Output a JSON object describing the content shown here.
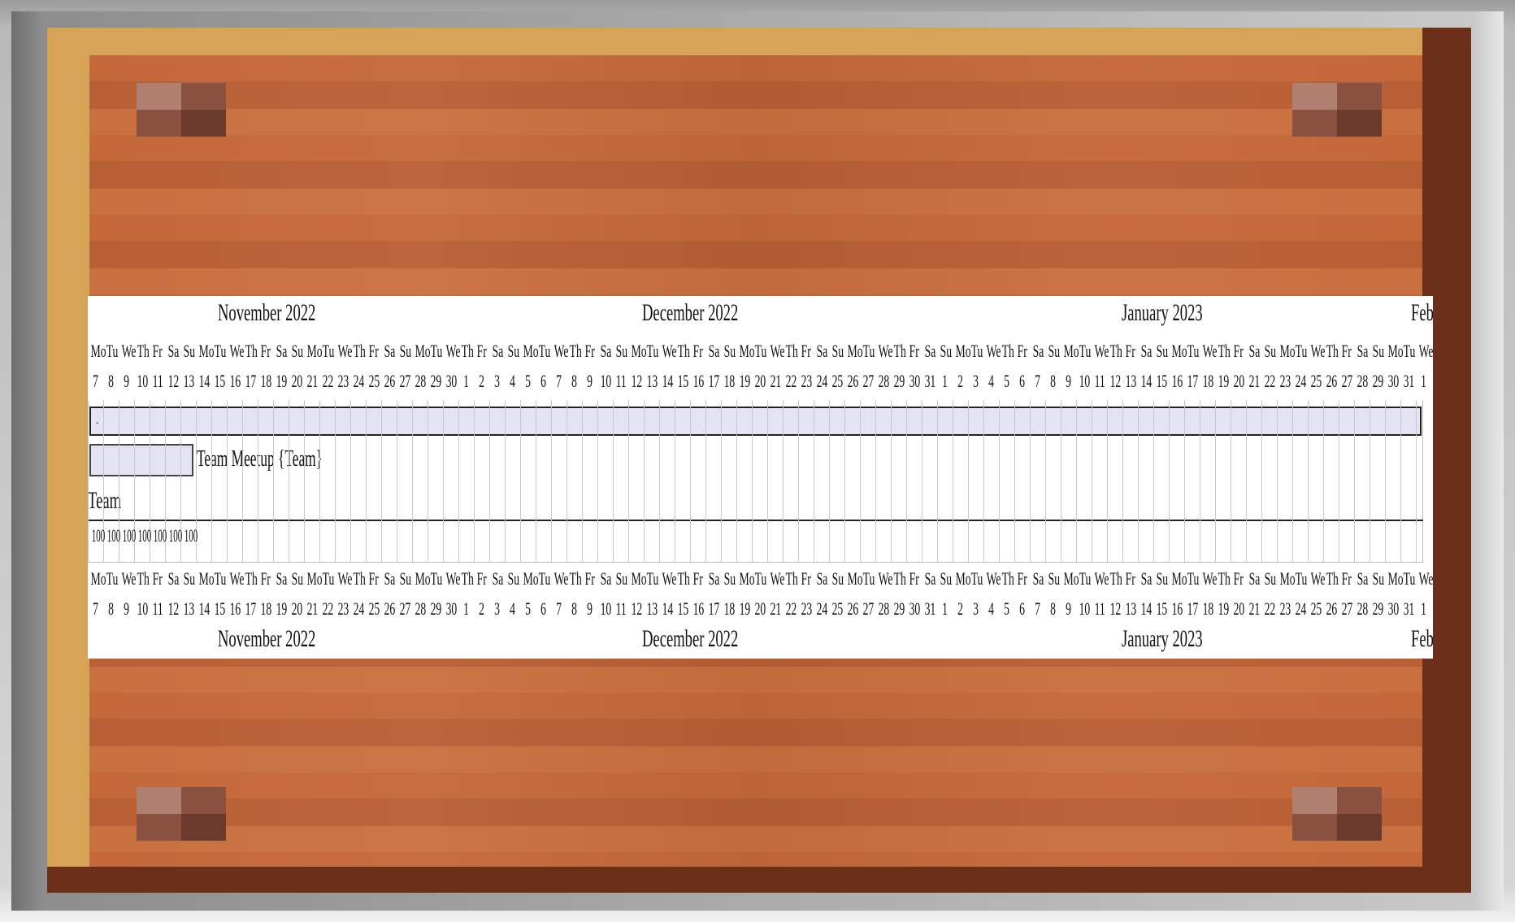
{
  "board": {
    "colors": {
      "wood": "#c4683a",
      "wood_dark": "#6b2f1a",
      "wood_highlight": "#d6a456",
      "frame": "#b9b9b9"
    },
    "stud_icons": [
      "stud-icon",
      "stud-icon",
      "stud-icon",
      "stud-icon"
    ]
  },
  "gantt": {
    "months": [
      {
        "label": "November 2022"
      },
      {
        "label": "December 2022"
      },
      {
        "label": "January 2023"
      },
      {
        "label": "Feb"
      }
    ],
    "day_names": [
      "Mo",
      "Tu",
      "We",
      "Th",
      "Fr",
      "Sa",
      "Su",
      "Mo",
      "Tu",
      "We",
      "Th",
      "Fr",
      "Sa",
      "Su",
      "Mo",
      "Tu",
      "We",
      "Th",
      "Fr",
      "Sa",
      "Su",
      "Mo",
      "Tu",
      "We",
      "Th",
      "Fr",
      "Sa",
      "Su",
      "Mo",
      "Tu",
      "We",
      "Th",
      "Fr",
      "Sa",
      "Su",
      "Mo",
      "Tu",
      "We",
      "Th",
      "Fr",
      "Sa",
      "Su",
      "Mo",
      "Tu",
      "We",
      "Th",
      "Fr",
      "Sa",
      "Su",
      "Mo",
      "Tu",
      "We",
      "Th",
      "Fr",
      "Sa",
      "Su",
      "Mo",
      "Tu",
      "We",
      "Th",
      "Fr",
      "Sa",
      "Su",
      "Mo",
      "Tu",
      "We",
      "Th",
      "Fr",
      "Sa",
      "Su",
      "Mo",
      "Tu",
      "We",
      "Th",
      "Fr",
      "Sa",
      "Su",
      "Mo",
      "Tu",
      "We",
      "Th",
      "Fr",
      "Sa",
      "Su",
      "Mo",
      "Tu",
      "We"
    ],
    "day_numbers": [
      "7",
      "8",
      "9",
      "10",
      "11",
      "12",
      "13",
      "14",
      "15",
      "16",
      "17",
      "18",
      "19",
      "20",
      "21",
      "22",
      "23",
      "24",
      "25",
      "26",
      "27",
      "28",
      "29",
      "30",
      "1",
      "2",
      "3",
      "4",
      "5",
      "6",
      "7",
      "8",
      "9",
      "10",
      "11",
      "12",
      "13",
      "14",
      "15",
      "16",
      "17",
      "18",
      "19",
      "20",
      "21",
      "22",
      "23",
      "24",
      "25",
      "26",
      "27",
      "28",
      "29",
      "30",
      "31",
      "1",
      "2",
      "3",
      "4",
      "5",
      "6",
      "7",
      "8",
      "9",
      "10",
      "11",
      "12",
      "13",
      "14",
      "15",
      "16",
      "17",
      "18",
      "19",
      "20",
      "21",
      "22",
      "23",
      "24",
      "25",
      "26",
      "27",
      "28",
      "29",
      "30",
      "31",
      "1"
    ],
    "project_band_label": ".",
    "task": {
      "label": "Team Meetup {Team}"
    },
    "resource": {
      "label": "Team",
      "load": [
        "100",
        "100",
        "100",
        "100",
        "100",
        "100",
        "100"
      ]
    },
    "colors": {
      "bar_fill": "#e4e4f4",
      "bar_border": "#222222",
      "grid": "#c8c8c8"
    }
  }
}
